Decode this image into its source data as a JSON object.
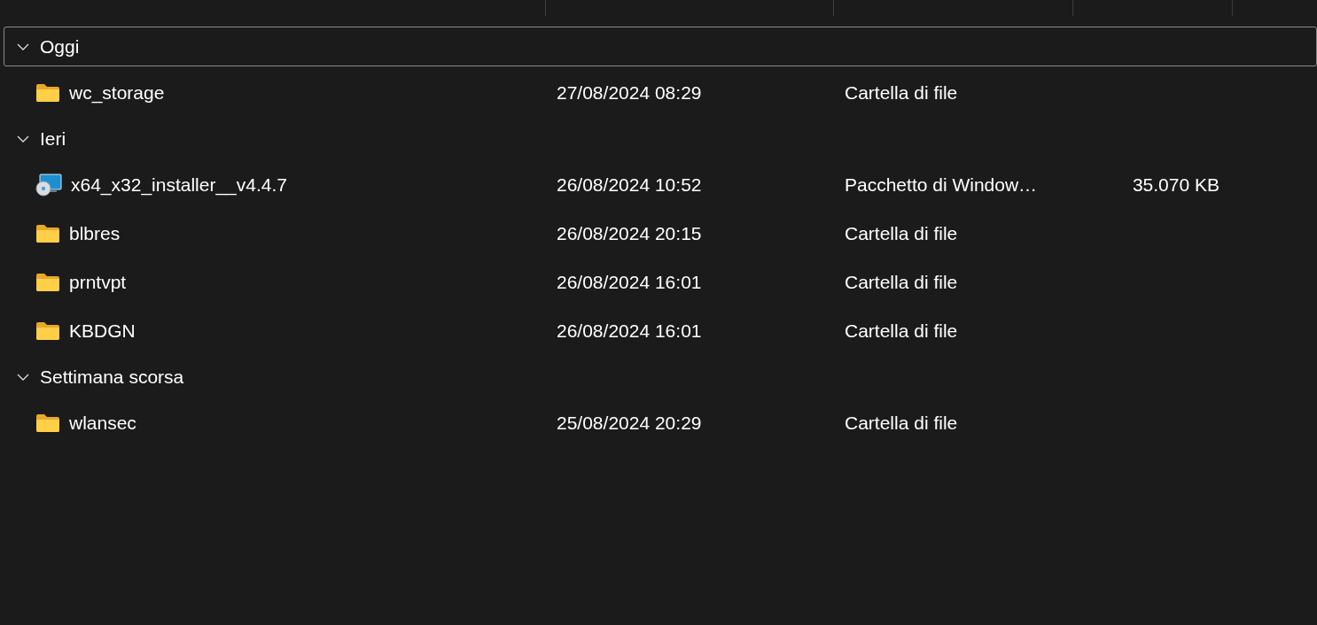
{
  "groups": [
    {
      "label": "Oggi",
      "expanded": true,
      "selected": true,
      "items": [
        {
          "kind": "folder",
          "name": "wc_storage",
          "modified": "27/08/2024 08:29",
          "type": "Cartella di file"
        }
      ]
    },
    {
      "label": "Ieri",
      "expanded": true,
      "selected": false,
      "items": [
        {
          "kind": "package",
          "name": "x64_x32_installer__v4.4.7",
          "modified": "26/08/2024 10:52",
          "type": "Pacchetto di Window…",
          "size": "35.070 KB"
        },
        {
          "kind": "folder",
          "name": "blbres",
          "modified": "26/08/2024 20:15",
          "type": "Cartella di file"
        },
        {
          "kind": "folder",
          "name": "prntvpt",
          "modified": "26/08/2024 16:01",
          "type": "Cartella di file"
        },
        {
          "kind": "folder",
          "name": "KBDGN",
          "modified": "26/08/2024 16:01",
          "type": "Cartella di file"
        }
      ]
    },
    {
      "label": "Settimana scorsa",
      "expanded": true,
      "selected": false,
      "items": [
        {
          "kind": "folder",
          "name": "wlansec",
          "modified": "25/08/2024 20:29",
          "type": "Cartella di file"
        }
      ]
    }
  ]
}
